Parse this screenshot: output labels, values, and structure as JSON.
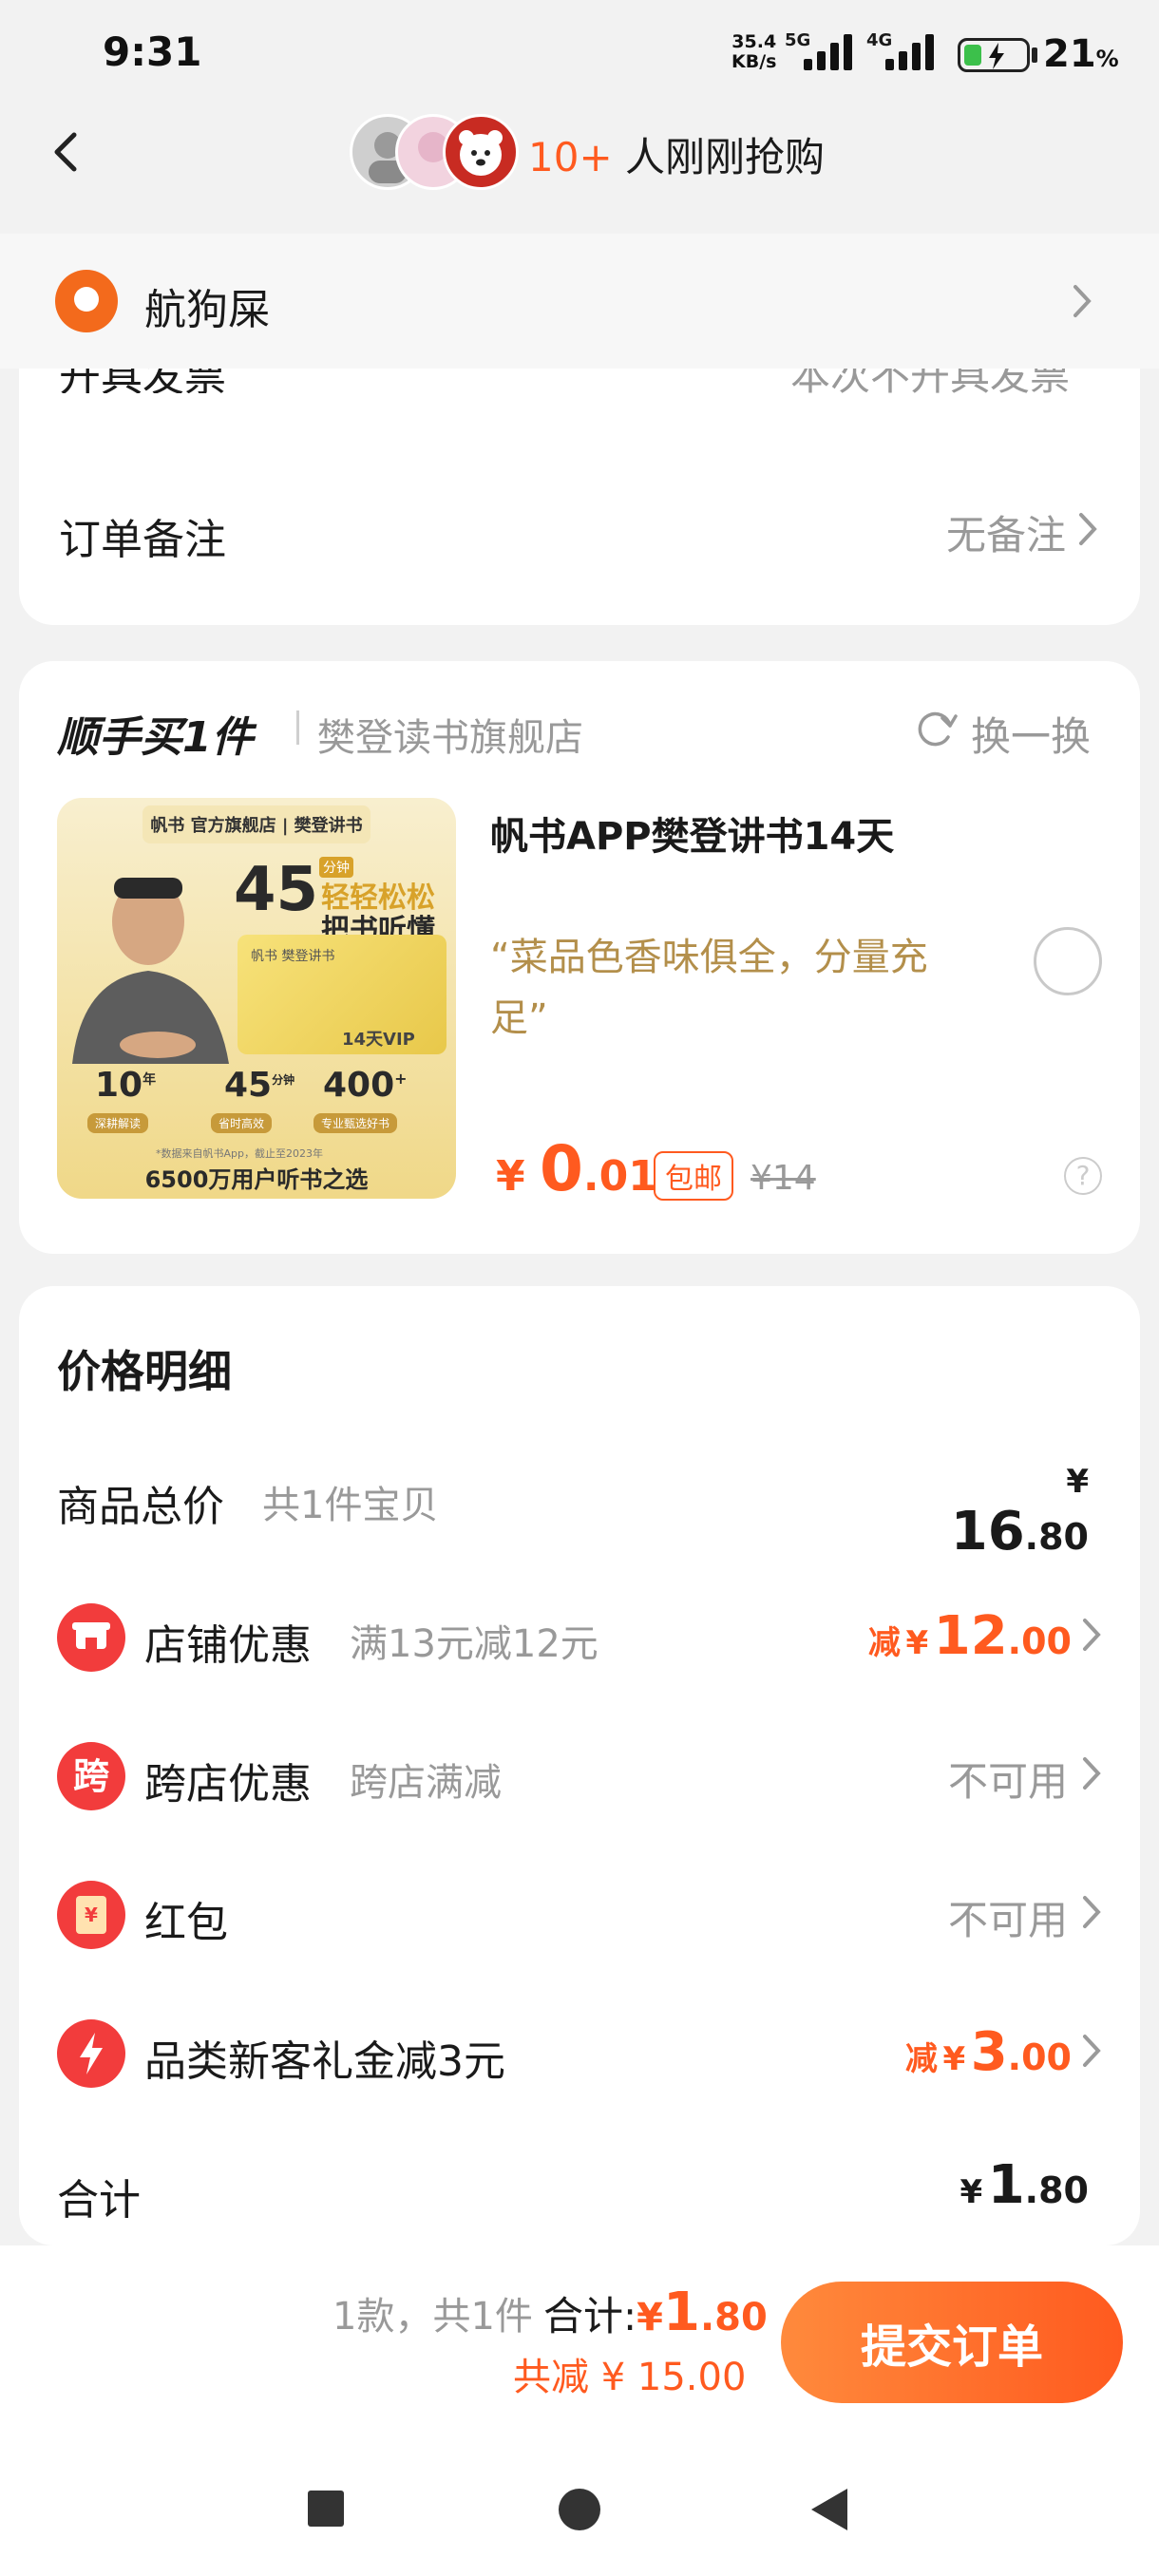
{
  "status_bar": {
    "time": "9:31",
    "net_speed_top": "35.4",
    "net_speed_unit": "KB/s",
    "net1": "5G",
    "net2": "4G",
    "battery_pct": "21",
    "battery_sign": "%"
  },
  "header": {
    "buyers_count": "10+",
    "buyers_text": " 人刚刚抢购"
  },
  "address": {
    "name": "航狗屎"
  },
  "invoice_row": {
    "label": "开具发票",
    "value": "本次不开具发票"
  },
  "note_row": {
    "label": "订单备注",
    "value": "无备注"
  },
  "addon": {
    "title": "顺手买1件",
    "store": "樊登读书旗舰店",
    "swap": "换一换",
    "product_title": "帆书APP樊登讲书14天",
    "quote": "“菜品色香味俱全，分量充足”",
    "price_symbol": "¥",
    "price_int": "0",
    "price_dec": ".01",
    "free_ship": "包邮",
    "orig_price": "¥14",
    "image": {
      "brand": "帆书 官方旗舰店 | 樊登讲书",
      "big_num": "45",
      "min": "分钟",
      "slogan1": "轻轻松松",
      "slogan2": "把书听懂",
      "card_brand": "帆书 樊登讲书",
      "card_vip": "14天VIP",
      "stat1_num": "10",
      "stat1_unit": "年",
      "stat1_label": "深耕解读",
      "stat2_num": "45",
      "stat2_unit": "分钟",
      "stat2_label": "省时高效",
      "stat3_num": "400",
      "stat3_unit": "+",
      "stat3_label": "专业甄选好书",
      "fine_print": "*数据来自帆书App，截止至2023年",
      "footer": "6500万用户听书之选"
    }
  },
  "price_detail": {
    "title": "价格明细",
    "rows": [
      {
        "label": "商品总价",
        "sub": "共1件宝贝",
        "prefix": "",
        "sym": "¥",
        "int": "16",
        "dec": ".80"
      },
      {
        "label": "店铺优惠",
        "sub": "满13元减12元",
        "prefix": "减",
        "sym": "¥",
        "int": "12",
        "dec": ".00"
      },
      {
        "label": "跨店优惠",
        "sub": "跨店满减",
        "value": "不可用"
      },
      {
        "label": "红包",
        "sub": "",
        "value": "不可用"
      },
      {
        "label": "品类新客礼金减3元",
        "sub": "",
        "prefix": "减",
        "sym": "¥",
        "int": "3",
        "dec": ".00"
      },
      {
        "label": "合计",
        "sub": "",
        "prefix": "",
        "sym": "¥",
        "int": "1",
        "dec": ".80"
      }
    ],
    "icon_kua": "跨",
    "icon_hb": "¥"
  },
  "bottom": {
    "count": "1款，共1件",
    "total_label": "合计:",
    "total_sym": "¥",
    "total_int": "1",
    "total_dec": ".80",
    "saved": "共减 ¥ 15.00",
    "submit": "提交订单"
  },
  "colors": {
    "accent": "#ff5a1f",
    "gold": "#b38f4b"
  }
}
